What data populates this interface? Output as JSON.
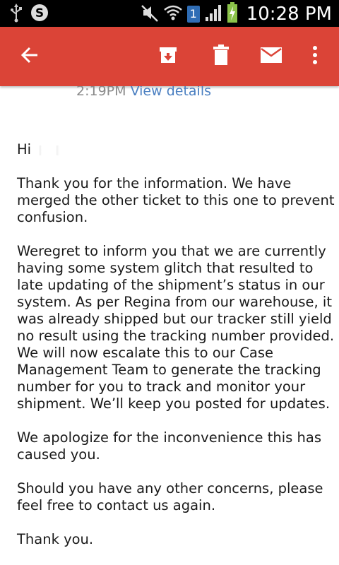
{
  "status_bar": {
    "time": "10:28 PM",
    "sim_slot": "1",
    "icons": [
      "usb-icon",
      "skype-icon",
      "mute-icon",
      "wifi-icon",
      "signal-icon",
      "battery-charging-icon"
    ]
  },
  "app_bar": {
    "icons": [
      "back-arrow-icon",
      "archive-icon",
      "delete-icon",
      "mark-unread-icon",
      "more-options-icon"
    ],
    "color": "#db4437"
  },
  "email": {
    "meta_time": "2:19PM",
    "view_details": "View details",
    "greeting": "Hi",
    "paragraphs": [
      "Thank you for the information. We have merged the other ticket to this one to prevent confusion.",
      "Weregret to inform you that we are currently having some system glitch that resulted to late updating of the shipment’s status in our system. As per Regina from our warehouse, it was already shipped but our tracker still yield no result using the tracking number provided. We will now escalate this to our Case Management Team to generate the tracking number for you to track and monitor your shipment. We’ll keep you posted for updates.",
      "We apologize for the inconvenience this has caused you.",
      "Should you have any other concerns, please feel free to contact us again.",
      "Thank you."
    ],
    "link_color": "#4a7fc1"
  }
}
